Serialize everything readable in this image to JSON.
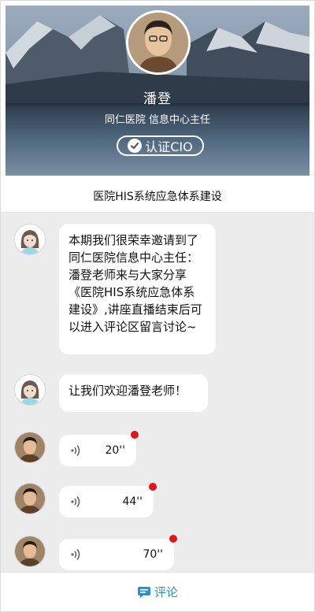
{
  "profile": {
    "name": "潘登",
    "subtitle": "同仁医院 信息中心主任",
    "badge_label": "认证CIO"
  },
  "page_title": "医院HIS系统应急体系建设",
  "messages": [
    {
      "type": "text",
      "sender": "host",
      "text": "本期我们很荣幸邀请到了同仁医院信息中心主任：潘登老师来与大家分享《医院HIS系统应急体系建设》,讲座直播结束后可以进入评论区留言讨论~"
    },
    {
      "type": "text",
      "sender": "host",
      "text": "让我们欢迎潘登老师！"
    },
    {
      "type": "voice",
      "sender": "speaker",
      "duration": "20''",
      "unread": true
    },
    {
      "type": "voice",
      "sender": "speaker",
      "duration": "44''",
      "unread": true
    },
    {
      "type": "voice",
      "sender": "speaker",
      "duration": "70''",
      "unread": true
    }
  ],
  "footer": {
    "comment_label": "评论",
    "icon": "comment-icon"
  },
  "colors": {
    "accent": "#2a90d6",
    "unread_dot": "#e5141c",
    "chat_bg": "#ececec"
  }
}
